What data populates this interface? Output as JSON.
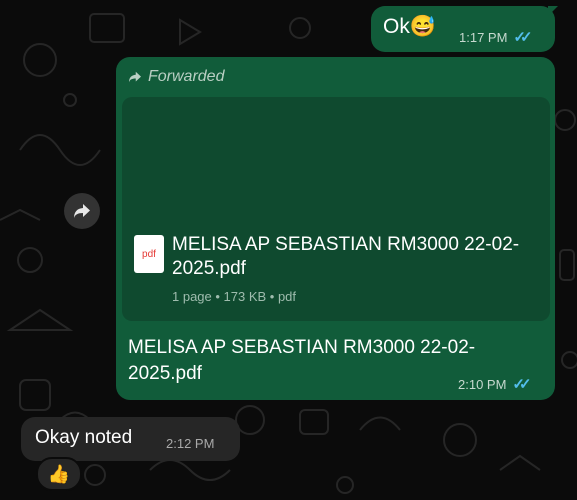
{
  "colors": {
    "outgoing_bubble": "#115c3a",
    "incoming_bubble": "#262626",
    "read_ticks": "#53bdeb",
    "background": "#0b0b0b"
  },
  "messages": [
    {
      "direction": "out",
      "text": "Ok😅",
      "time": "1:17 PM",
      "status": "read",
      "status_icon": "double-check-icon"
    },
    {
      "direction": "out",
      "forwarded_label": "Forwarded",
      "document": {
        "icon_label": "pdf",
        "title": "MELISA AP SEBASTIAN RM3000 22-02-2025.pdf",
        "info": "1 page • 173 KB • pdf"
      },
      "caption": "MELISA AP SEBASTIAN RM3000 22-02-2025.pdf",
      "time": "2:10 PM",
      "status": "read",
      "status_icon": "double-check-icon"
    },
    {
      "direction": "in",
      "text": "Okay noted",
      "time": "2:12 PM",
      "reaction": "👍"
    }
  ]
}
